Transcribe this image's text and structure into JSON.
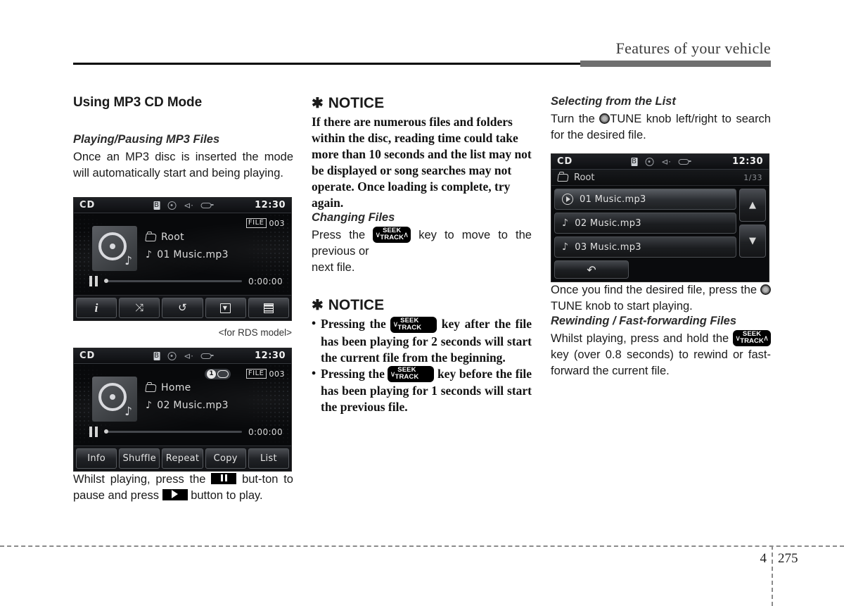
{
  "header": {
    "title": "Features of your vehicle"
  },
  "footer": {
    "chapter": "4",
    "page": "275"
  },
  "col1": {
    "section_title": "Using MP3 CD Mode",
    "sub1_title": "Playing/Pausing MP3 Files",
    "sub1_body": "Once an MP3 disc is inserted the mode will automatically start and being playing.",
    "caption": "<for RDS model>",
    "closing_1": "Whilst playing, press the",
    "closing_2": "but-ton to pause and press",
    "closing_3": "button to play.",
    "screen1": {
      "mode": "CD",
      "clock": "12:30",
      "file_tag": "FILE",
      "file_number": "003",
      "folder": "Root",
      "track": "01 Music.mp3",
      "elapsed": "0:00:00",
      "icons": [
        "bluetooth-icon",
        "disc-icon",
        "usb-icon",
        "aux-icon"
      ],
      "buttons": [
        {
          "label": "",
          "icon": "info-icon"
        },
        {
          "label": "",
          "icon": "shuffle-icon"
        },
        {
          "label": "",
          "icon": "repeat-icon"
        },
        {
          "label": "",
          "icon": "copy-icon"
        },
        {
          "label": "",
          "icon": "list-icon"
        }
      ]
    },
    "screen2": {
      "mode": "CD",
      "clock": "12:30",
      "file_tag": "FILE",
      "file_number": "003",
      "repeat_badge": "1",
      "folder": "Home",
      "track": "02 Music.mp3",
      "elapsed": "0:00:00",
      "buttons": [
        {
          "label": "Info"
        },
        {
          "label": "Shuffle"
        },
        {
          "label": "Repeat"
        },
        {
          "label": "Copy"
        },
        {
          "label": "List"
        }
      ]
    }
  },
  "col2": {
    "notice1_title": "NOTICE",
    "notice1_body": "If there are numerous files and folders within the disc, reading time could take more than 10 seconds and the list may not be displayed or song searches may not operate. Once loading is complete, try again.",
    "sub2_title": "Changing Files",
    "sub2_before": "Press the",
    "sub2_mid": "key to move to the previous or",
    "sub2_after": "next file.",
    "notice2_title": "NOTICE",
    "bullet1_before": "Pressing the",
    "bullet1_after": "key after the file has been playing for 2 seconds will start the current file from the beginning.",
    "bullet2_before": "Pressing the",
    "bullet2_after": "key before the file has been playing for 1 seconds will start the previous file.",
    "seek_key": {
      "top": "SEEK",
      "bottom": "TRACK",
      "chev_down": "∨",
      "chev_up": "∧"
    }
  },
  "col3": {
    "sub3_title": "Selecting from the List",
    "sub3_before": "Turn the",
    "sub3_after": "TUNE knob left/right to search for the desired file.",
    "after_list_before": "Once you find the desired file, press the",
    "after_list_after": "TUNE knob to start playing.",
    "sub4_title": "Rewinding / Fast-forwarding Files",
    "sub4_before": "Whilst playing, press and hold the",
    "sub4_after": "key (over 0.8 seconds) to rewind or fast-forward the current file.",
    "screen3": {
      "mode": "CD",
      "clock": "12:30",
      "folder": "Root",
      "counter": "1/33",
      "rows": [
        {
          "label": "01 Music.mp3",
          "icon": "play-circle-icon",
          "selected": true
        },
        {
          "label": "02 Music.mp3",
          "icon": "music-note-icon",
          "selected": false
        },
        {
          "label": "03 Music.mp3",
          "icon": "music-note-icon",
          "selected": false
        }
      ],
      "scroll_up": "▲",
      "scroll_down": "▼",
      "back": "↶"
    }
  }
}
